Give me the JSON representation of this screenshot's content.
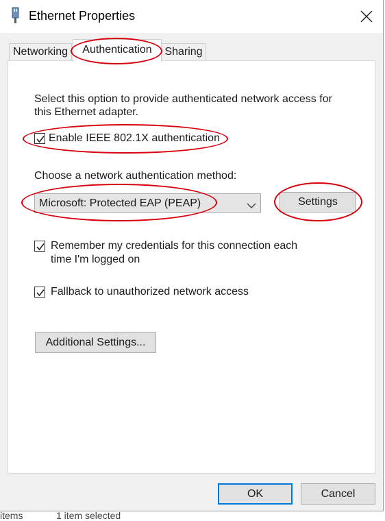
{
  "window": {
    "title": "Ethernet Properties",
    "icon": "network-adapter-icon",
    "close_icon": "close-icon"
  },
  "tabs": [
    {
      "label": "Networking",
      "active": false
    },
    {
      "label": "Authentication",
      "active": true
    },
    {
      "label": "Sharing",
      "active": false
    }
  ],
  "auth": {
    "description_line1": "Select this option to provide authenticated network access for",
    "description_line2": "this Ethernet adapter.",
    "enable_8021x": {
      "label": "Enable IEEE 802.1X authentication",
      "checked": true
    },
    "method_label": "Choose a network authentication method:",
    "method_select": {
      "value": "Microsoft: Protected EAP (PEAP)",
      "icon": "chevron-down-icon"
    },
    "settings_button": "Settings",
    "remember_credentials": {
      "label_line1": "Remember my credentials for this connection each",
      "label_line2": "time I'm logged on",
      "checked": true
    },
    "fallback": {
      "label": "Fallback to unauthorized network access",
      "checked": true
    },
    "additional_settings_button": "Additional Settings..."
  },
  "footer": {
    "ok_button": "OK",
    "cancel_button": "Cancel"
  },
  "background_statusbar": {
    "items_text": "items",
    "selected_text": "1 item selected"
  },
  "colors": {
    "annotation_red": "#d8000c",
    "focus_blue": "#0078d7",
    "dialog_bg": "#f0f0f0"
  }
}
